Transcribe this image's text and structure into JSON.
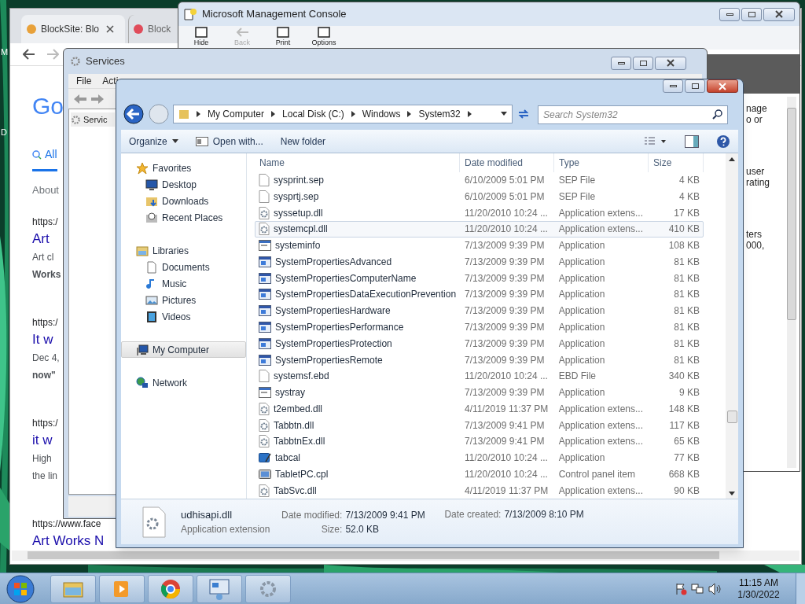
{
  "desktop_icons": [
    {
      "label": "M"
    },
    {
      "label": "D"
    }
  ],
  "browser": {
    "tabs": [
      {
        "label": "BlockSite: Blo",
        "selected": true
      },
      {
        "label": "Block",
        "selected": false
      }
    ],
    "logo": "Go",
    "search_tabs": [
      {
        "label": "All",
        "selected": true
      }
    ],
    "stats": "About",
    "results": [
      {
        "url": "https:/",
        "title": "Art",
        "lines": [
          "Art cl",
          "**Works**"
        ]
      },
      {
        "url": "https:/",
        "title": "It w",
        "lines": [
          "Dec 4,",
          "**now\"**"
        ]
      },
      {
        "url": "https:/",
        "title": "it w",
        "lines": [
          "High",
          "the lin"
        ]
      },
      {
        "url": "https://www.face",
        "title": "Art Works N"
      }
    ]
  },
  "mmc": {
    "title": "Microsoft Management Console",
    "toolbar": [
      {
        "label": "Hide",
        "disabled": false
      },
      {
        "label": "Back",
        "disabled": true
      },
      {
        "label": "Print",
        "disabled": false
      },
      {
        "label": "Options",
        "disabled": false
      }
    ],
    "text_fragments": [
      [
        "nage",
        "o or"
      ],
      [
        "user",
        "rating"
      ],
      [
        "ters",
        "000,"
      ]
    ]
  },
  "services": {
    "title": "Services",
    "menu": [
      "File",
      "Acti"
    ],
    "tree": [
      "Servic"
    ]
  },
  "explorer": {
    "breadcrumb": [
      "My Computer",
      "Local Disk (C:)",
      "Windows",
      "System32"
    ],
    "search_placeholder": "Search System32",
    "toolbar": [
      {
        "label": "Organize",
        "dropdown": true
      },
      {
        "label": "Open with...",
        "dropdown": false
      },
      {
        "label": "New folder",
        "dropdown": false
      }
    ],
    "nav": [
      {
        "label": "Favorites",
        "kind": "star",
        "selected": false,
        "children": [
          {
            "label": "Desktop",
            "kind": "desktop",
            "selected": false
          },
          {
            "label": "Downloads",
            "kind": "downloads",
            "selected": false
          },
          {
            "label": "Recent Places",
            "kind": "recent",
            "selected": false
          }
        ]
      },
      {
        "label": "Libraries",
        "kind": "library",
        "selected": false,
        "children": [
          {
            "label": "Documents",
            "kind": "documents",
            "selected": false
          },
          {
            "label": "Music",
            "kind": "music",
            "selected": false
          },
          {
            "label": "Pictures",
            "kind": "pictures",
            "selected": false
          },
          {
            "label": "Videos",
            "kind": "videos",
            "selected": false
          }
        ]
      },
      {
        "label": "My Computer",
        "kind": "computer",
        "selected": true
      },
      {
        "label": "Network",
        "kind": "network",
        "selected": false
      }
    ],
    "columns": [
      "Name",
      "Date modified",
      "Type",
      "Size"
    ],
    "rows": [
      {
        "name": "sysprint.sep",
        "date": "6/10/2009 5:01 PM",
        "type": "SEP File",
        "size": "4 KB",
        "kind": "blank",
        "hovered": false
      },
      {
        "name": "sysprtj.sep",
        "date": "6/10/2009 5:01 PM",
        "type": "SEP File",
        "size": "4 KB",
        "kind": "blank",
        "hovered": false
      },
      {
        "name": "syssetup.dll",
        "date": "11/20/2010 10:24 ...",
        "type": "Application extens...",
        "size": "17 KB",
        "kind": "gear",
        "hovered": false
      },
      {
        "name": "systemcpl.dll",
        "date": "11/20/2010 10:24 ...",
        "type": "Application extens...",
        "size": "410 KB",
        "kind": "gear",
        "hovered": true
      },
      {
        "name": "systeminfo",
        "date": "7/13/2009 9:39 PM",
        "type": "Application",
        "size": "108 KB",
        "kind": "app",
        "hovered": false
      },
      {
        "name": "SystemPropertiesAdvanced",
        "date": "7/13/2009 9:39 PM",
        "type": "Application",
        "size": "81 KB",
        "kind": "props",
        "hovered": false
      },
      {
        "name": "SystemPropertiesComputerName",
        "date": "7/13/2009 9:39 PM",
        "type": "Application",
        "size": "81 KB",
        "kind": "props",
        "hovered": false
      },
      {
        "name": "SystemPropertiesDataExecutionPrevention",
        "date": "7/13/2009 9:39 PM",
        "type": "Application",
        "size": "81 KB",
        "kind": "props",
        "hovered": false
      },
      {
        "name": "SystemPropertiesHardware",
        "date": "7/13/2009 9:39 PM",
        "type": "Application",
        "size": "81 KB",
        "kind": "props",
        "hovered": false
      },
      {
        "name": "SystemPropertiesPerformance",
        "date": "7/13/2009 9:39 PM",
        "type": "Application",
        "size": "81 KB",
        "kind": "props",
        "hovered": false
      },
      {
        "name": "SystemPropertiesProtection",
        "date": "7/13/2009 9:39 PM",
        "type": "Application",
        "size": "81 KB",
        "kind": "props",
        "hovered": false
      },
      {
        "name": "SystemPropertiesRemote",
        "date": "7/13/2009 9:39 PM",
        "type": "Application",
        "size": "81 KB",
        "kind": "props",
        "hovered": false
      },
      {
        "name": "systemsf.ebd",
        "date": "11/20/2010 10:24 ...",
        "type": "EBD File",
        "size": "340 KB",
        "kind": "blank",
        "hovered": false
      },
      {
        "name": "systray",
        "date": "7/13/2009 9:39 PM",
        "type": "Application",
        "size": "9 KB",
        "kind": "app",
        "hovered": false
      },
      {
        "name": "t2embed.dll",
        "date": "4/11/2019 11:37 PM",
        "type": "Application extens...",
        "size": "148 KB",
        "kind": "gear",
        "hovered": false
      },
      {
        "name": "Tabbtn.dll",
        "date": "7/13/2009 9:41 PM",
        "type": "Application extens...",
        "size": "117 KB",
        "kind": "gear",
        "hovered": false
      },
      {
        "name": "TabbtnEx.dll",
        "date": "7/13/2009 9:41 PM",
        "type": "Application extens...",
        "size": "65 KB",
        "kind": "gear",
        "hovered": false
      },
      {
        "name": "tabcal",
        "date": "11/20/2010 10:24 ...",
        "type": "Application",
        "size": "77 KB",
        "kind": "pen",
        "hovered": false
      },
      {
        "name": "TabletPC.cpl",
        "date": "11/20/2010 10:24 ...",
        "type": "Control panel item",
        "size": "668 KB",
        "kind": "cpl",
        "hovered": false
      },
      {
        "name": "TabSvc.dll",
        "date": "4/11/2019 11:37 PM",
        "type": "Application extens...",
        "size": "90 KB",
        "kind": "gear",
        "hovered": false
      }
    ],
    "details": {
      "name": "udhisapi.dll",
      "type": "Application extension",
      "fields": [
        {
          "label": "Date modified:",
          "value": "7/13/2009 9:41 PM"
        },
        {
          "label": "Size:",
          "value": "52.0 KB"
        },
        {
          "label": "Date created:",
          "value": "7/13/2009 8:10 PM"
        }
      ]
    }
  },
  "taskbar": {
    "time": "11:15 AM",
    "date": "1/30/2022"
  }
}
